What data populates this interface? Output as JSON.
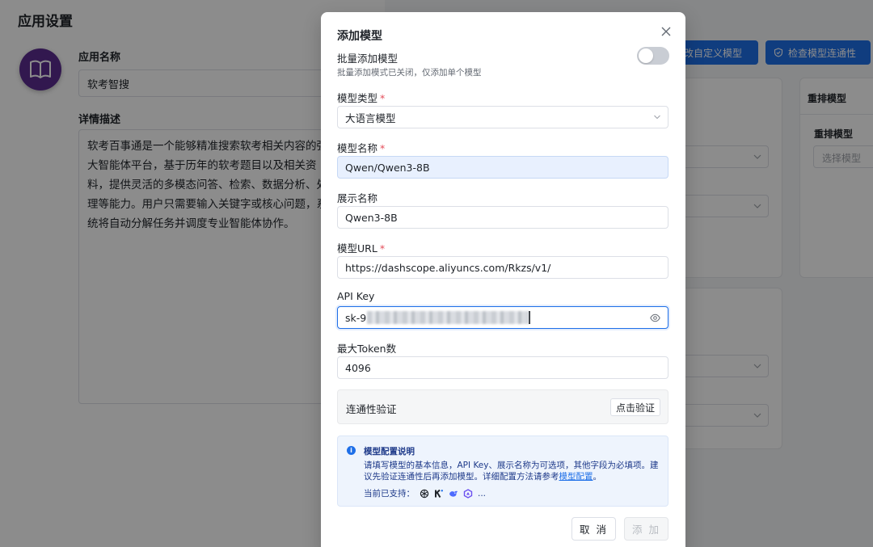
{
  "background": {
    "page_title": "应用设置",
    "app_name_label": "应用名称",
    "app_name_value": "软考智搜",
    "description_label": "详情描述",
    "description_value": "软考百事通是一个能够精准搜索软考相关内容的强大智能体平台，基于历年的软考题目以及相关资料，提供灵活的多模态问答、检索、数据分析、处理等能力。用户只需要输入关键字或核心问题，系统将自动分解任务并调度专业智能体协作。",
    "btn_custom_model": "改自定义模型",
    "btn_check_connectivity": "检查模型连通性",
    "rerank_header": "重排模型",
    "rerank_label": "重排模型",
    "rerank_placeholder": "选择模型"
  },
  "modal": {
    "title": "添加模型",
    "batch_label": "批量添加模型",
    "batch_hint": "批量添加模式已关闭，仅添加单个模型",
    "batch_enabled": false,
    "model_type_label": "模型类型",
    "model_type_value": "大语言模型",
    "model_name_label": "模型名称",
    "model_name_value": "Qwen/Qwen3-8B",
    "display_name_label": "展示名称",
    "display_name_value": "Qwen3-8B",
    "url_label": "模型URL",
    "url_value": "https://dashscope.aliyuncs.com/Rkzs/v1/",
    "api_key_label": "API Key",
    "api_key_prefix": "sk-9",
    "max_token_label": "最大Token数",
    "max_token_value": "4096",
    "verify_label": "连通性验证",
    "verify_button": "点击验证",
    "info_title": "模型配置说明",
    "info_text": "请填写模型的基本信息，API Key、展示名称为可选项，其他字段为必填项。建议先验证连通性后再添加模型。详细配置方法请参考",
    "info_link": "模型配置",
    "info_period": "。",
    "support_label": "当前已支持：",
    "support_more": "...",
    "cancel_button": "取 消",
    "add_button": "添 加"
  },
  "required_mark": "*",
  "colors": {
    "primary": "#1e6fe8",
    "avatar": "#5b2d90",
    "required": "#e34d59"
  }
}
